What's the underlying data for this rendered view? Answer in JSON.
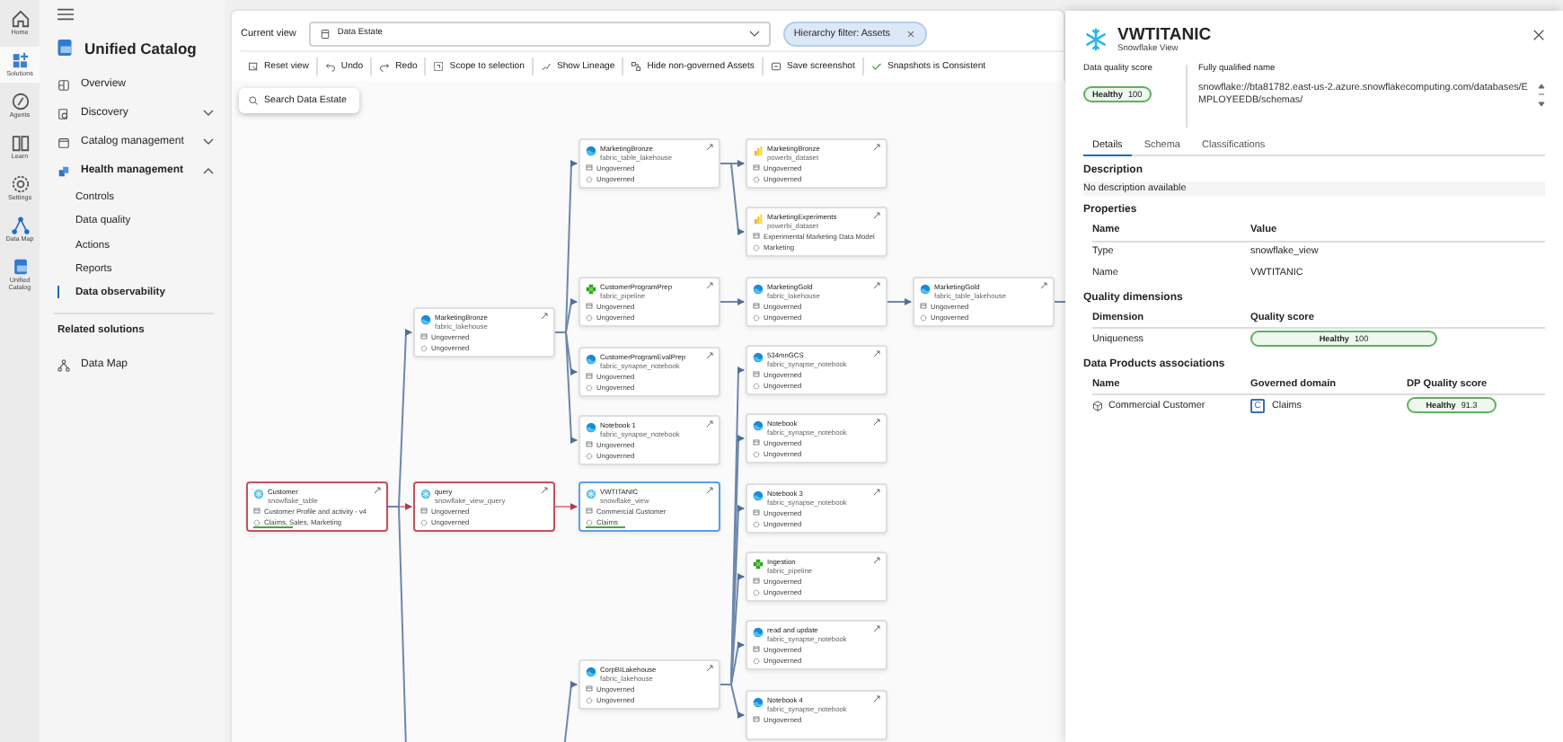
{
  "rail": [
    {
      "label": "Home",
      "kind": "home",
      "selected": false
    },
    {
      "label": "Solutions",
      "kind": "solutions",
      "selected": true
    },
    {
      "label": "Agents",
      "kind": "agents",
      "selected": false
    },
    {
      "label": "Learn",
      "kind": "learn",
      "selected": false
    },
    {
      "label": "Settings",
      "kind": "settings",
      "selected": false
    },
    {
      "label": "Data Map",
      "kind": "datamap",
      "selected": false
    },
    {
      "label": "Unified Catalog",
      "kind": "catalog",
      "selected": false
    }
  ],
  "sidebar": {
    "title": "Unified Catalog",
    "items": [
      {
        "label": "Overview",
        "kind": "overview"
      },
      {
        "label": "Discovery",
        "kind": "discovery",
        "expanded": false
      },
      {
        "label": "Catalog management",
        "kind": "management",
        "expanded": false
      },
      {
        "label": "Health management",
        "kind": "health",
        "expanded": true,
        "children": [
          {
            "label": "Controls",
            "selected": false
          },
          {
            "label": "Data quality",
            "selected": false
          },
          {
            "label": "Actions",
            "selected": false
          },
          {
            "label": "Reports",
            "selected": false
          },
          {
            "label": "Data observability",
            "selected": true
          }
        ]
      }
    ],
    "related": {
      "heading": "Related solutions",
      "items": [
        {
          "label": "Data Map",
          "kind": "datamap"
        }
      ]
    }
  },
  "topbar": {
    "view_label": "Current view",
    "view_value": "Data Estate",
    "filter_chip": "Hierarchy filter: Assets"
  },
  "toolbar": [
    {
      "label": "Reset view",
      "kind": "reset"
    },
    {
      "label": "Undo",
      "kind": "undo"
    },
    {
      "label": "Redo",
      "kind": "redo"
    },
    {
      "label": "Scope to selection",
      "kind": "scope"
    },
    {
      "label": "Show Lineage",
      "kind": "lineage"
    },
    {
      "label": "Hide non-governed Assets",
      "kind": "hide"
    },
    {
      "label": "Save screenshot",
      "kind": "screenshot"
    },
    {
      "label": "Snapshots is Consistent",
      "kind": "check"
    }
  ],
  "search_button": "Search Data Estate",
  "nodes": [
    {
      "title": "Customer",
      "subtitle": "snowflake_table",
      "kind": "snowflake",
      "on_path": true,
      "selected": false,
      "score_bar": true,
      "rows": [
        "Customer Profile and activity - v4",
        "Claims, Sales, Marketing"
      ]
    },
    {
      "title": "MarketingBronze",
      "subtitle": "fabric_lakehouse",
      "kind": "lakehouse",
      "on_path": false,
      "selected": false,
      "rows": [
        "Ungoverned",
        "Ungoverned"
      ]
    },
    {
      "title": "query",
      "subtitle": "snowflake_view_query",
      "kind": "snowflake",
      "on_path": true,
      "selected": false,
      "rows": [
        "Ungoverned",
        "Ungoverned"
      ]
    },
    {
      "title": "MarketingBronze",
      "subtitle": "fabric_table_lakehouse",
      "kind": "lakehouse",
      "on_path": false,
      "selected": false,
      "rows": [
        "Ungoverned",
        "Ungoverned"
      ]
    },
    {
      "title": "CustomerProgramPrep",
      "subtitle": "fabric_pipeline",
      "kind": "pipeline",
      "on_path": false,
      "selected": false,
      "rows": [
        "Ungoverned",
        "Ungoverned"
      ]
    },
    {
      "title": "CustomerProgramEvalPrep",
      "subtitle": "fabric_synapse_notebook",
      "kind": "lakehouse",
      "on_path": false,
      "selected": false,
      "rows": [
        "Ungoverned",
        "Ungoverned"
      ]
    },
    {
      "title": "Notebook 1",
      "subtitle": "fabric_synapse_notebook",
      "kind": "lakehouse",
      "on_path": false,
      "selected": false,
      "rows": [
        "Ungoverned",
        "Ungoverned"
      ]
    },
    {
      "title": "VWTITANIC",
      "subtitle": "snowflake_view",
      "kind": "snowflake",
      "on_path": false,
      "selected": true,
      "score_bar": true,
      "rows": [
        "Commercial Customer",
        "Claims"
      ]
    },
    {
      "title": "CorpBILakehouse",
      "subtitle": "fabric_lakehouse",
      "kind": "lakehouse",
      "on_path": false,
      "selected": false,
      "rows": [
        "Ungoverned",
        "Ungoverned"
      ]
    },
    {
      "title": "MarketingBronze",
      "subtitle": "powerbi_dataset",
      "kind": "powerbi",
      "on_path": false,
      "selected": false,
      "rows": [
        "Ungoverned",
        "Ungoverned"
      ]
    },
    {
      "title": "MarketingExperiments",
      "subtitle": "powerbi_dataset",
      "kind": "powerbi",
      "on_path": false,
      "selected": false,
      "rows": [
        "Experimental Marketing Data Model",
        "Marketing"
      ]
    },
    {
      "title": "MarketingGold",
      "subtitle": "fabric_lakehouse",
      "kind": "lakehouse",
      "on_path": false,
      "selected": false,
      "rows": [
        "Ungoverned",
        "Ungoverned"
      ]
    },
    {
      "title": "534mnGCS",
      "subtitle": "fabric_synapse_notebook",
      "kind": "lakehouse",
      "on_path": false,
      "selected": false,
      "rows": [
        "Ungoverned",
        "Ungoverned"
      ]
    },
    {
      "title": "Notebook",
      "subtitle": "fabric_synapse_notebook",
      "kind": "lakehouse",
      "on_path": false,
      "selected": false,
      "rows": [
        "Ungoverned",
        "Ungoverned"
      ]
    },
    {
      "title": "Notebook 3",
      "subtitle": "fabric_synapse_notebook",
      "kind": "lakehouse",
      "on_path": false,
      "selected": false,
      "rows": [
        "Ungoverned",
        "Ungoverned"
      ]
    },
    {
      "title": "Ingestion",
      "subtitle": "fabric_pipeline",
      "kind": "pipeline",
      "on_path": false,
      "selected": false,
      "rows": [
        "Ungoverned",
        "Ungoverned"
      ]
    },
    {
      "title": "read and update",
      "subtitle": "fabric_synapse_notebook",
      "kind": "lakehouse",
      "on_path": false,
      "selected": false,
      "rows": [
        "Ungoverned",
        "Ungoverned"
      ]
    },
    {
      "title": "Notebook 4",
      "subtitle": "fabric_synapse_notebook",
      "kind": "lakehouse",
      "on_path": false,
      "selected": false,
      "rows": [
        "Ungoverned"
      ]
    },
    {
      "title": "MarketingGold",
      "subtitle": "fabric_table_lakehouse",
      "kind": "lakehouse",
      "on_path": false,
      "selected": false,
      "rows": [
        "Ungoverned",
        "Ungoverned"
      ]
    }
  ],
  "panel": {
    "title": "VWTITANIC",
    "subtitle": "Snowflake View",
    "score_label": "Data quality score",
    "score_badge": {
      "status": "Healthy",
      "value": "100"
    },
    "fqn_label": "Fully qualified name",
    "fqn": "snowflake://bta81782.east-us-2.azure.snowflakecomputing.com/databases/EMPLOYEEDB/schemas/",
    "tabs": [
      {
        "label": "Details",
        "selected": true
      },
      {
        "label": "Schema",
        "selected": false
      },
      {
        "label": "Classifications",
        "selected": false
      }
    ],
    "description_heading": "Description",
    "description": "No description available",
    "properties": {
      "heading": "Properties",
      "columns": [
        "Name",
        "Value"
      ],
      "rows": [
        [
          "Type",
          "snowflake_view"
        ],
        [
          "Name",
          "VWTITANIC"
        ]
      ]
    },
    "quality": {
      "heading": "Quality dimensions",
      "columns": [
        "Dimension",
        "Quality score"
      ],
      "rows": [
        {
          "dimension": "Uniqueness",
          "status": "Healthy",
          "value": "100"
        }
      ]
    },
    "products": {
      "heading": "Data Products associations",
      "columns": [
        "Name",
        "Governed domain",
        "DP Quality score"
      ],
      "rows": [
        {
          "name": "Commercial Customer",
          "domain_letter": "C",
          "domain": "Claims",
          "status": "Healthy",
          "value": "91.3"
        }
      ]
    }
  }
}
